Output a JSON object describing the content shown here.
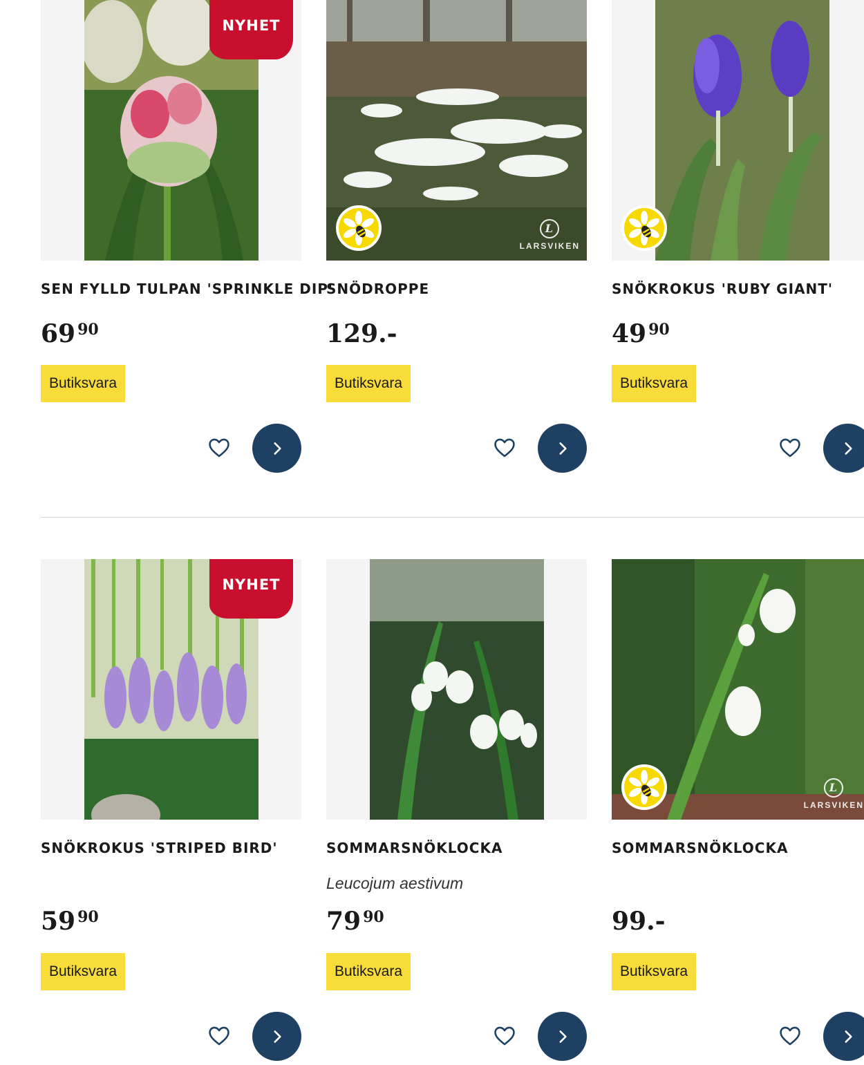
{
  "colors": {
    "accent": "#1e4163",
    "badge_red": "#c8102e",
    "stock_yellow": "#f7dc3a"
  },
  "badges": {
    "new_label": "NYHET",
    "pollinator_icon": "bee-flower-icon",
    "brand": "LARSVIKEN"
  },
  "products": [
    {
      "name": "SEN FYLLD TULPAN 'SPRINKLE DIP'",
      "price_main": "69",
      "price_cents": "90",
      "stock": "Butiksvara",
      "latin": ""
    },
    {
      "name": "SNÖDROPPE",
      "price_main": "129.-",
      "price_cents": "",
      "stock": "Butiksvara",
      "latin": ""
    },
    {
      "name": "SNÖKROKUS 'RUBY GIANT'",
      "price_main": "49",
      "price_cents": "90",
      "stock": "Butiksvara",
      "latin": ""
    },
    {
      "name": "SNÖKROKUS 'STRIPED BIRD'",
      "price_main": "59",
      "price_cents": "90",
      "stock": "Butiksvara",
      "latin": ""
    },
    {
      "name": "SOMMARSNÖKLOCKA",
      "price_main": "79",
      "price_cents": "90",
      "stock": "Butiksvara",
      "latin": "Leucojum aestivum"
    },
    {
      "name": "SOMMARSNÖKLOCKA",
      "price_main": "99.-",
      "price_cents": "",
      "stock": "Butiksvara",
      "latin": ""
    }
  ]
}
